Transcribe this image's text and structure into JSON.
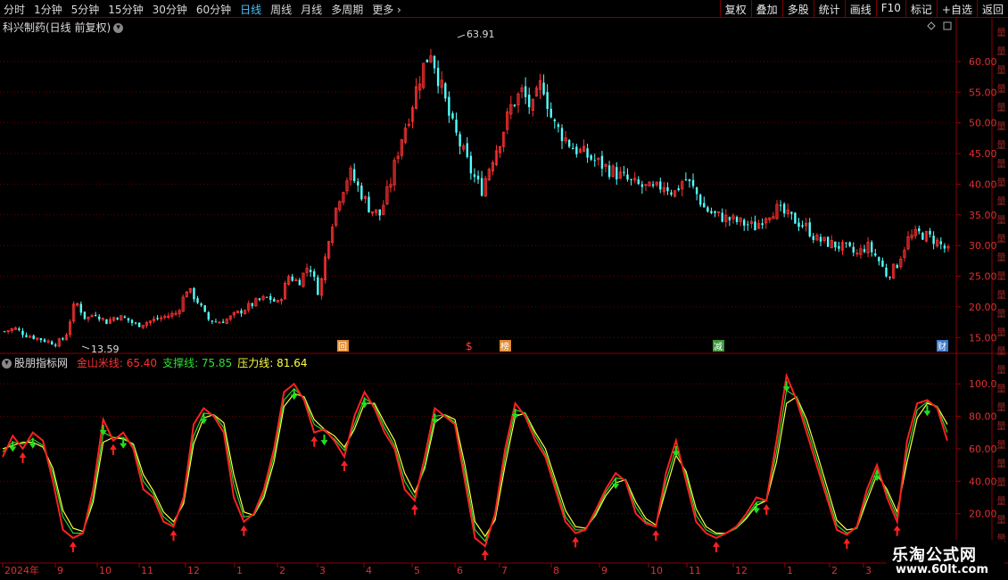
{
  "toolbar": {
    "periods": [
      "分时",
      "1分钟",
      "5分钟",
      "15分钟",
      "30分钟",
      "60分钟",
      "日线",
      "周线",
      "月线",
      "多周期",
      "更多"
    ],
    "active_period": "日线",
    "more_glyph": "›",
    "actions": [
      "复权",
      "叠加",
      "多股",
      "统计",
      "画线",
      "F10",
      "标记",
      "+自选",
      "返回"
    ]
  },
  "main_panel": {
    "title": "科兴制药(日线 前复权)",
    "icons": [
      "chevron-down-icon",
      "diamond-icon",
      "rectangle-icon"
    ],
    "price_axis": [
      "60.00",
      "55.00",
      "50.00",
      "45.00",
      "40.00",
      "35.00",
      "30.00",
      "25.00",
      "20.00",
      "15.00"
    ],
    "high_label": "63.91",
    "low_label": "13.59",
    "markers": [
      "回",
      "$",
      "榜",
      "减",
      "财"
    ],
    "right_strip": "量"
  },
  "indicator_panel": {
    "title": "股朋指标网",
    "lines": [
      {
        "name": "金山米线",
        "value": "65.40",
        "color": "#ff3030"
      },
      {
        "name": "支撑线",
        "value": "75.85",
        "color": "#30e030"
      },
      {
        "name": "压力线",
        "value": "81.64",
        "color": "#ffff40"
      }
    ],
    "axis": [
      "100.0",
      "80.00",
      "60.00",
      "40.00",
      "20.00"
    ]
  },
  "time_axis": [
    "2024年",
    "9",
    "10",
    "11",
    "12",
    "1",
    "2",
    "3",
    "4",
    "5",
    "6",
    "7",
    "8",
    "9",
    "10",
    "11",
    "12",
    "1",
    "2",
    "3"
  ],
  "watermark": {
    "line1": "乐淘公式网",
    "line2": "www.60lt.com"
  },
  "chart_data": {
    "type": "candlestick",
    "title": "科兴制药(日线 前复权)",
    "y_range": [
      13.59,
      63.91
    ],
    "close_path": [
      16,
      16.5,
      15.5,
      15,
      14.5,
      14,
      15,
      21,
      18,
      19,
      17.5,
      18.5,
      18,
      17,
      17.5,
      18,
      18.5,
      19,
      23,
      21,
      18,
      17.5,
      18,
      19,
      20,
      21,
      21.5,
      20.5,
      25,
      24,
      27,
      22,
      32,
      38,
      42,
      39,
      36,
      35,
      40,
      47,
      52,
      58,
      62,
      56,
      50,
      46,
      42,
      39,
      44,
      48,
      53,
      55,
      52,
      57,
      50,
      48,
      46,
      45,
      44,
      43,
      42,
      41,
      40,
      39.5,
      39,
      40,
      38.5,
      41,
      39,
      36,
      35,
      34.5,
      34,
      33.5,
      33,
      35,
      36,
      35,
      34,
      33,
      31,
      30.5,
      30,
      29.5,
      28.5,
      30,
      28,
      25,
      27,
      31,
      32,
      31.5,
      30.5,
      29
    ],
    "indicator_range": [
      0,
      110
    ],
    "indicator": {
      "jinshan": [
        55,
        68,
        60,
        70,
        65,
        40,
        10,
        5,
        8,
        35,
        78,
        65,
        70,
        60,
        35,
        30,
        15,
        12,
        30,
        75,
        85,
        80,
        70,
        30,
        15,
        20,
        35,
        60,
        95,
        100,
        90,
        70,
        72,
        65,
        55,
        80,
        95,
        85,
        70,
        60,
        35,
        28,
        55,
        85,
        80,
        75,
        40,
        5,
        0,
        20,
        60,
        88,
        80,
        65,
        55,
        35,
        15,
        8,
        10,
        22,
        35,
        45,
        40,
        20,
        14,
        12,
        45,
        65,
        40,
        15,
        8,
        5,
        8,
        12,
        20,
        30,
        28,
        65,
        105,
        90,
        70,
        50,
        30,
        10,
        7,
        12,
        35,
        50,
        30,
        15,
        65,
        88,
        90,
        85,
        65
      ],
      "support": [
        58,
        64,
        63,
        66,
        62,
        45,
        18,
        8,
        8,
        30,
        70,
        67,
        67,
        62,
        40,
        32,
        18,
        13,
        28,
        68,
        82,
        81,
        73,
        38,
        18,
        19,
        32,
        56,
        90,
        97,
        91,
        75,
        71,
        66,
        59,
        75,
        91,
        87,
        73,
        62,
        40,
        30,
        50,
        80,
        81,
        76,
        45,
        10,
        3,
        18,
        55,
        84,
        82,
        68,
        57,
        38,
        18,
        10,
        10,
        20,
        33,
        42,
        41,
        24,
        15,
        12,
        40,
        60,
        44,
        19,
        10,
        7,
        8,
        11,
        18,
        27,
        28,
        58,
        96,
        92,
        74,
        54,
        33,
        13,
        8,
        11,
        31,
        47,
        33,
        18,
        58,
        84,
        89,
        86,
        70
      ],
      "pressure": [
        60,
        62,
        64,
        64,
        61,
        48,
        22,
        11,
        9,
        27,
        64,
        67,
        66,
        63,
        44,
        34,
        21,
        15,
        26,
        63,
        79,
        81,
        76,
        44,
        21,
        19,
        30,
        52,
        86,
        94,
        92,
        78,
        72,
        68,
        61,
        72,
        88,
        88,
        76,
        65,
        45,
        33,
        48,
        76,
        81,
        78,
        50,
        15,
        6,
        16,
        50,
        80,
        82,
        70,
        60,
        41,
        22,
        12,
        11,
        19,
        31,
        39,
        41,
        27,
        17,
        13,
        35,
        56,
        46,
        23,
        12,
        8,
        8,
        11,
        17,
        25,
        28,
        52,
        88,
        92,
        78,
        58,
        37,
        16,
        10,
        11,
        28,
        44,
        35,
        21,
        52,
        79,
        88,
        86,
        75
      ]
    }
  }
}
